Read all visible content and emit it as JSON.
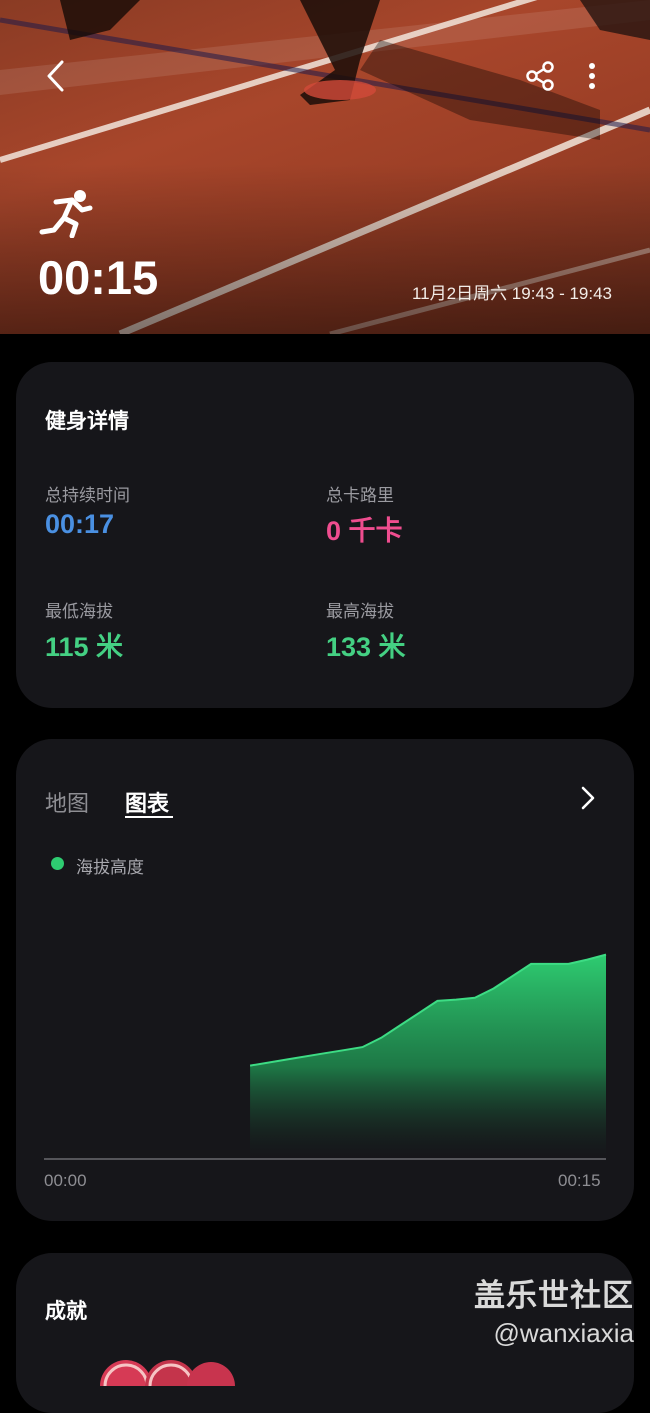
{
  "header": {
    "duration": "00:15",
    "date_range": "11月2日周六 19:43 - 19:43",
    "activity_icon": "running-person-icon"
  },
  "details": {
    "title": "健身详情",
    "total_duration_label": "总持续时间",
    "total_duration_value": "00:17",
    "total_calories_label": "总卡路里",
    "total_calories_value": "0 千卡",
    "min_altitude_label": "最低海拔",
    "min_altitude_value": "115 米",
    "max_altitude_label": "最高海拔",
    "max_altitude_value": "133 米",
    "colors": {
      "duration": "#4a90e2",
      "calories": "#ef4d8f",
      "altitude": "#44d083"
    }
  },
  "chart_section": {
    "tab_map": "地图",
    "tab_chart": "图表",
    "legend": "海拔高度",
    "legend_color": "#2ecc71",
    "x_start": "00:00",
    "x_end": "00:15"
  },
  "chart_data": {
    "type": "area",
    "title": "",
    "series": [
      {
        "name": "海拔高度",
        "x_seconds": [
          5.5,
          6.5,
          7.5,
          8.0,
          8.5,
          9.0,
          9.5,
          10.0,
          10.5,
          11.0,
          11.5,
          12.0,
          12.5,
          13.0,
          13.5,
          14.0,
          14.5,
          15.0
        ],
        "values": [
          115,
          116,
          117,
          117.5,
          118,
          119.5,
          121.5,
          123.5,
          125.5,
          125.7,
          126,
          127.5,
          129.5,
          131.5,
          131.5,
          131.5,
          132.2,
          133
        ]
      }
    ],
    "xlim": [
      0,
      15
    ],
    "ylim": [
      100,
      137
    ],
    "xlabel": "",
    "ylabel": ""
  },
  "achievements": {
    "title": "成就"
  },
  "watermark": {
    "line1": "盖乐世社区",
    "line2": "@wanxiaxia"
  }
}
